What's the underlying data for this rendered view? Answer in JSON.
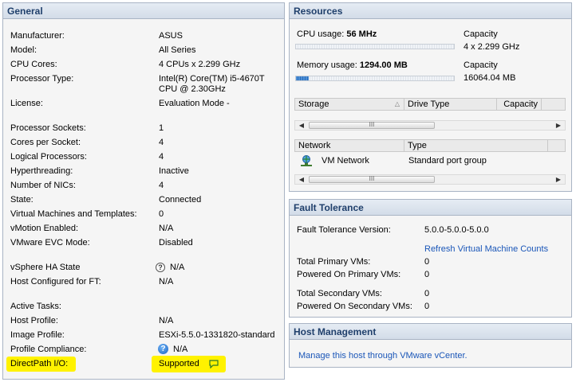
{
  "general": {
    "title": "General",
    "rows": [
      {
        "label": "Manufacturer:",
        "value": "ASUS"
      },
      {
        "label": "Model:",
        "value": "All Series"
      },
      {
        "label": "CPU Cores:",
        "value": "4 CPUs x 2.299 GHz"
      },
      {
        "label": "Processor Type:",
        "value": "Intel(R) Core(TM) i5-4670T",
        "value2": "CPU @ 2.30GHz"
      },
      {
        "label": "License:",
        "value": "Evaluation Mode -"
      },
      {
        "label": "Processor Sockets:",
        "value": "1"
      },
      {
        "label": "Cores per Socket:",
        "value": "4"
      },
      {
        "label": "Logical Processors:",
        "value": "4"
      },
      {
        "label": "Hyperthreading:",
        "value": "Inactive"
      },
      {
        "label": "Number of NICs:",
        "value": "4"
      },
      {
        "label": "State:",
        "value": "Connected"
      },
      {
        "label": "Virtual Machines and Templates:",
        "value": "0"
      },
      {
        "label": "vMotion Enabled:",
        "value": "N/A"
      },
      {
        "label": "VMware EVC Mode:",
        "value": "Disabled"
      },
      {
        "label": "vSphere HA State",
        "value": "N/A"
      },
      {
        "label": "Host Configured for FT:",
        "value": "N/A"
      },
      {
        "label": "Active Tasks:",
        "value": ""
      },
      {
        "label": "Host Profile:",
        "value": "N/A"
      },
      {
        "label": "Image Profile:",
        "value": "ESXi-5.5.0-1331820-standard"
      },
      {
        "label": "Profile Compliance:",
        "value": "N/A"
      },
      {
        "label": "DirectPath I/O:",
        "value": "Supported"
      }
    ]
  },
  "resources": {
    "title": "Resources",
    "cpu_label": "CPU usage:",
    "cpu_value": "56 MHz",
    "cpu_fraction": 0.0,
    "cpu_capacity_label": "Capacity",
    "cpu_capacity_value": "4 x 2.299 GHz",
    "mem_label": "Memory usage:",
    "mem_value": "1294.00 MB",
    "mem_fraction": 0.08,
    "mem_capacity_label": "Capacity",
    "mem_capacity_value": "16064.04 MB",
    "storage_columns": [
      "Storage",
      "Drive Type",
      "Capacity"
    ],
    "network_columns": [
      "Network",
      "Type"
    ],
    "network_rows": [
      {
        "name": "VM Network",
        "type": "Standard port group"
      }
    ],
    "scroll_grip": "III"
  },
  "fault_tolerance": {
    "title": "Fault Tolerance",
    "version_label": "Fault Tolerance Version:",
    "version_value": "5.0.0-5.0.0-5.0.0",
    "refresh_link": "Refresh Virtual Machine Counts",
    "rows": [
      {
        "label": "Total Primary VMs:",
        "value": "0"
      },
      {
        "label": "Powered On Primary VMs:",
        "value": "0"
      },
      {
        "label": "Total Secondary VMs:",
        "value": "0"
      },
      {
        "label": "Powered On Secondary VMs:",
        "value": "0"
      }
    ]
  },
  "host_management": {
    "title": "Host Management",
    "link": "Manage this host through VMware vCenter."
  },
  "colors": {
    "highlight": "#fff200",
    "link": "#1a56b8",
    "header_text": "#1f3f6b"
  }
}
